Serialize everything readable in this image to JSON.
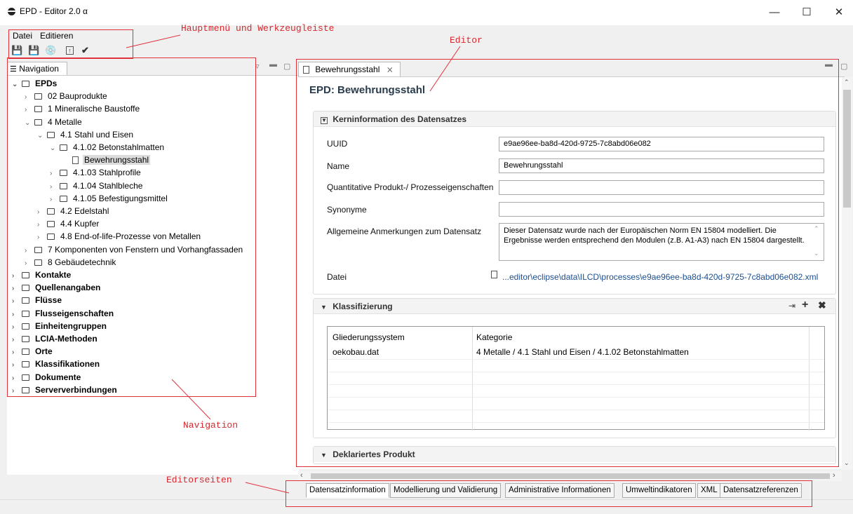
{
  "window": {
    "title": "EPD - Editor 2.0 α",
    "minimize": "—",
    "maximize": "☐",
    "close": "✕"
  },
  "menu": {
    "items": [
      "Datei",
      "Editieren"
    ]
  },
  "toolbar": {
    "icons": [
      "save-icon",
      "save-as-icon",
      "save-all-icon",
      "export-icon",
      "validate-icon"
    ]
  },
  "navigation": {
    "tab_label": "Navigation",
    "tree": [
      {
        "label": "EPDs",
        "bold": true,
        "type": "folder",
        "level": 0,
        "expanded": true
      },
      {
        "label": "02 Bauprodukte",
        "type": "folder",
        "level": 1
      },
      {
        "label": "1 Mineralische Baustoffe",
        "type": "folder",
        "level": 1
      },
      {
        "label": "4 Metalle",
        "type": "folder",
        "level": 1,
        "expanded": true
      },
      {
        "label": "4.1 Stahl und Eisen",
        "type": "folder",
        "level": 2,
        "expanded": true
      },
      {
        "label": "4.1.02 Betonstahlmatten",
        "type": "folder",
        "level": 3,
        "expanded": true
      },
      {
        "label": "Bewehrungsstahl",
        "type": "doc",
        "level": 4,
        "selected": true
      },
      {
        "label": "4.1.03 Stahlprofile",
        "type": "folder",
        "level": 3
      },
      {
        "label": "4.1.04 Stahlbleche",
        "type": "folder",
        "level": 3
      },
      {
        "label": "4.1.05 Befestigungsmittel",
        "type": "folder",
        "level": 3
      },
      {
        "label": "4.2 Edelstahl",
        "type": "folder",
        "level": 2
      },
      {
        "label": "4.4 Kupfer",
        "type": "folder",
        "level": 2
      },
      {
        "label": "4.8 End-of-life-Prozesse von Metallen",
        "type": "folder",
        "level": 2
      },
      {
        "label": "7 Komponenten von Fenstern und Vorhangfassaden",
        "type": "folder",
        "level": 1
      },
      {
        "label": "8 Gebäudetechnik",
        "type": "folder",
        "level": 1
      },
      {
        "label": "Kontakte",
        "bold": true,
        "type": "folder",
        "level": 0
      },
      {
        "label": "Quellenangaben",
        "bold": true,
        "type": "folder",
        "level": 0
      },
      {
        "label": "Flüsse",
        "bold": true,
        "type": "folder",
        "level": 0
      },
      {
        "label": "Flusseigenschaften",
        "bold": true,
        "type": "folder",
        "level": 0
      },
      {
        "label": "Einheitengruppen",
        "bold": true,
        "type": "folder",
        "level": 0
      },
      {
        "label": "LCIA-Methoden",
        "bold": true,
        "type": "folder",
        "level": 0
      },
      {
        "label": "Orte",
        "bold": true,
        "type": "folder",
        "level": 0
      },
      {
        "label": "Klassifikationen",
        "bold": true,
        "type": "folder",
        "level": 0
      },
      {
        "label": "Dokumente",
        "bold": true,
        "type": "folder",
        "level": 0
      },
      {
        "label": "Serververbindungen",
        "bold": true,
        "type": "folder",
        "level": 0
      }
    ]
  },
  "editor": {
    "tab_label": "Bewehrungsstahl",
    "title": "EPD: Bewehrungsstahl",
    "kern": {
      "header": "Kerninformation des Datensatzes",
      "uuid_label": "UUID",
      "uuid_value": "e9ae96ee-ba8d-420d-9725-7c8abd06e082",
      "name_label": "Name",
      "name_value": "Bewehrungsstahl",
      "quant_label": "Quantitative Produkt-/ Prozesseigenschaften",
      "quant_value": "",
      "syn_label": "Synonyme",
      "syn_value": "",
      "remarks_label": "Allgemeine Anmerkungen zum Datensatz",
      "remarks_value": "Dieser Datensatz wurde nach der Europäischen Norm EN 15804 modelliert. Die Ergebnisse werden entsprechend den Modulen (z.B. A1-A3) nach EN 15804 dargestellt.",
      "file_label": "Datei",
      "file_value": "...editor\\eclipse\\data\\ILCD\\processes\\e9ae96ee-ba8d-420d-9725-7c8abd06e082.xml"
    },
    "klass": {
      "header": "Klassifizierung",
      "columns": [
        "Gliederungssystem",
        "Kategorie"
      ],
      "rows": [
        [
          "oekobau.dat",
          "4 Metalle / 4.1 Stahl und Eisen / 4.1.02 Betonstahlmatten"
        ]
      ]
    },
    "dekl": {
      "header": "Deklariertes Produkt"
    },
    "pages": [
      "Datensatzinformation",
      "Modellierung und Validierung",
      "Administrative Informationen",
      "Umweltindikatoren",
      "XML",
      "Datensatzreferenzen"
    ]
  },
  "annotations": {
    "menu": "Hauptmenü und Werkzeugleiste",
    "editor": "Editor",
    "navigation": "Navigation",
    "pages": "Editorseiten"
  }
}
